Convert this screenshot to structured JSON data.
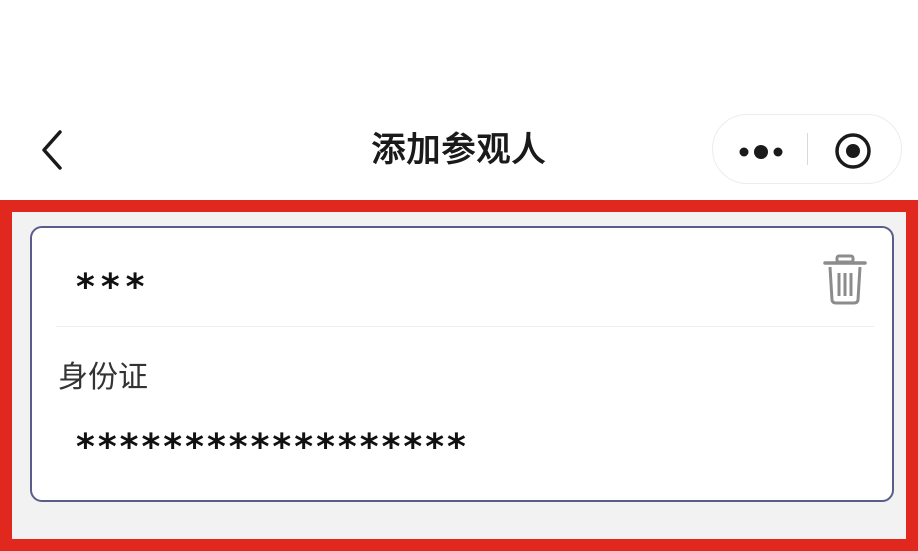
{
  "navbar": {
    "title": "添加参观人",
    "back_icon": "chevron-left-icon",
    "more_icon": "more-dots-icon",
    "close_icon": "target-circle-icon"
  },
  "visitor": {
    "name_masked": "***",
    "id_type_label": "身份证",
    "id_number_masked": "******************",
    "delete_icon": "trash-icon"
  },
  "colors": {
    "highlight_border": "#e0281e",
    "card_border": "#5c5c8a",
    "title_text": "#1a1a1a",
    "icon_gray": "#8c8c8c"
  }
}
